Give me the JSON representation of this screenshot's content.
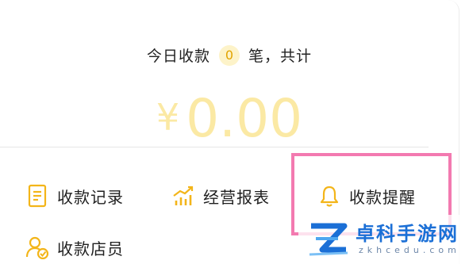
{
  "summary": {
    "prefix": "今日收款",
    "count": "0",
    "suffix": "笔，共计"
  },
  "amount": {
    "currency": "¥",
    "value": "0.00"
  },
  "menu": {
    "items": [
      {
        "label": "收款记录",
        "icon": "document-icon"
      },
      {
        "label": "经营报表",
        "icon": "bar-chart-icon"
      },
      {
        "label": "收款提醒",
        "icon": "bell-icon"
      },
      {
        "label": "收款店员",
        "icon": "staff-icon"
      }
    ]
  },
  "watermark": {
    "title": "卓科手游网",
    "url": "zkhcedu.com"
  },
  "colors": {
    "accent": "#f3b519",
    "highlight": "#f37ab0",
    "amount": "#fbe9a4",
    "brand": "#1b6fd6"
  }
}
